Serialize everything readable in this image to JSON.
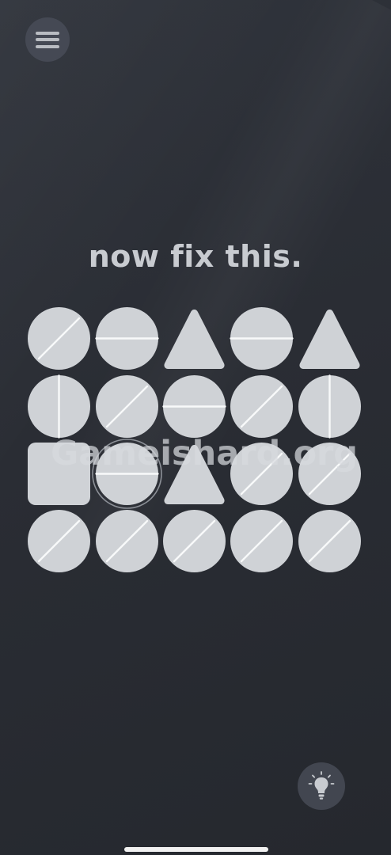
{
  "header": {
    "menu_icon": "hamburger-menu-icon"
  },
  "title": "now fix this.",
  "watermark": "Gameishard.org",
  "puzzle": {
    "selected": {
      "row": 2,
      "col": 1
    },
    "rows": [
      [
        {
          "shape": "circle",
          "line": "diagonal"
        },
        {
          "shape": "circle",
          "line": "horizontal"
        },
        {
          "shape": "triangle",
          "line": "none"
        },
        {
          "shape": "circle",
          "line": "horizontal"
        },
        {
          "shape": "triangle",
          "line": "none"
        }
      ],
      [
        {
          "shape": "circle",
          "line": "vertical"
        },
        {
          "shape": "circle",
          "line": "diagonal"
        },
        {
          "shape": "circle",
          "line": "horizontal"
        },
        {
          "shape": "circle",
          "line": "diagonal"
        },
        {
          "shape": "circle",
          "line": "vertical"
        }
      ],
      [
        {
          "shape": "square",
          "line": "none"
        },
        {
          "shape": "circle",
          "line": "horizontal"
        },
        {
          "shape": "triangle",
          "line": "none"
        },
        {
          "shape": "circle",
          "line": "diagonal"
        },
        {
          "shape": "circle",
          "line": "diagonal"
        }
      ],
      [
        {
          "shape": "circle",
          "line": "diagonal"
        },
        {
          "shape": "circle",
          "line": "diagonal"
        },
        {
          "shape": "circle",
          "line": "diagonal"
        },
        {
          "shape": "circle",
          "line": "diagonal"
        },
        {
          "shape": "circle",
          "line": "diagonal"
        }
      ]
    ]
  },
  "hint_button": {
    "icon": "lightbulb-icon"
  },
  "colors": {
    "shape_fill": "#cfd2d6",
    "line_color": "#f8f9fa",
    "ring_color": "#8d9198",
    "background": "#2b2e35"
  }
}
